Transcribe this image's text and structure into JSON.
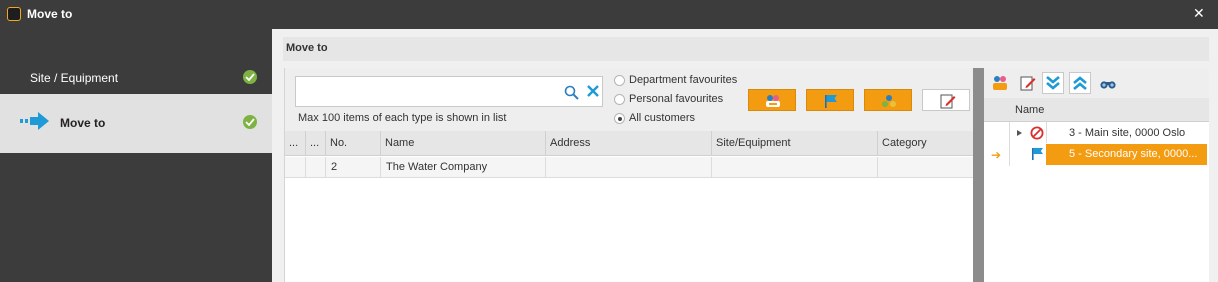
{
  "window": {
    "title": "Move to",
    "close_glyph": "✕"
  },
  "sidebar": {
    "steps": [
      {
        "label": "Site / Equipment",
        "icon": "check-circle-icon",
        "completed": true
      },
      {
        "label": "Move to",
        "icon": "check-circle-icon",
        "completed": true,
        "active": true
      }
    ]
  },
  "main": {
    "header": "Move to",
    "search": {
      "value": "",
      "placeholder": "",
      "hint": "Max 100 items of each type is shown in list"
    },
    "filters": {
      "options": [
        "Department favourites",
        "Personal favourites",
        "All customers"
      ],
      "selected": "All customers"
    },
    "action_buttons": [
      "department-customer-icon",
      "flag-icon",
      "group-icon",
      "edit-note-icon"
    ],
    "grid": {
      "columns": [
        "...",
        "...",
        "No.",
        "Name",
        "Address",
        "Site/Equipment",
        "Category"
      ],
      "rows": [
        {
          "c1": "",
          "c2": "",
          "no": "2",
          "name": "The Water Company",
          "address": "",
          "site": "",
          "category": ""
        }
      ]
    }
  },
  "right_panel": {
    "toolbar": [
      "customer-sites-icon",
      "edit-icon",
      "expand-all-icon",
      "collapse-all-icon",
      "binoculars-icon"
    ],
    "column": "Name",
    "tree": [
      {
        "label": "3 - Main site, 0000 Oslo",
        "icon": "prohibited-icon",
        "expandable": true,
        "selected": false
      },
      {
        "label": "5 - Secondary site, 0000...",
        "icon": "flag-icon",
        "expandable": false,
        "selected": true
      }
    ]
  },
  "colors": {
    "accent_orange": "#f39c12",
    "check_green": "#7cb342",
    "arrow_blue": "#1e9ad6",
    "dark_bg": "#3c3c3c"
  }
}
